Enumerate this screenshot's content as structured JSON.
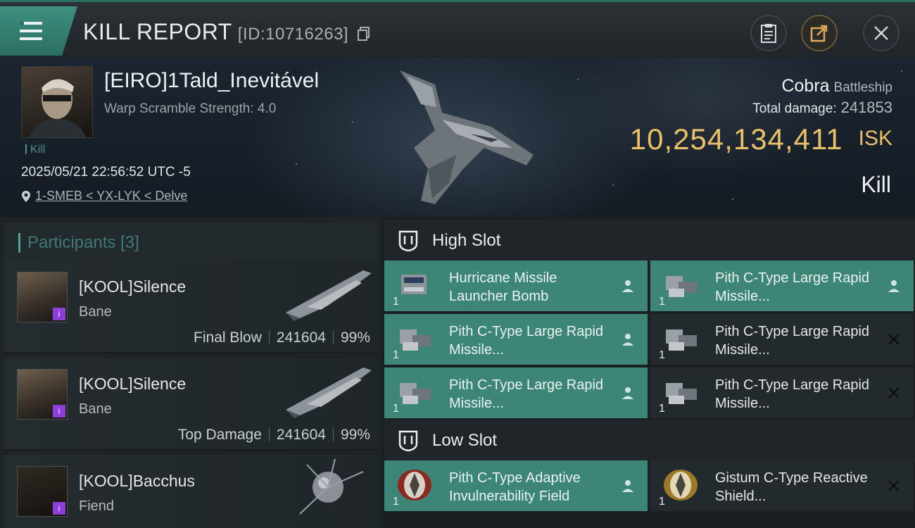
{
  "header": {
    "title": "KILL REPORT",
    "report_id": "[ID:10716263]"
  },
  "victim": {
    "name": "[EIRO]1Tald_Inevitável",
    "warp_scramble": "Warp Scramble Strength: 4.0",
    "tag": "Kill",
    "datetime": "2025/05/21 22:56:52 UTC -5",
    "location": "1-SMEB < YX-LYK < Delve",
    "ship_name": "Cobra",
    "ship_class": "Battleship",
    "total_damage_label": "Total damage:",
    "total_damage": "241853",
    "isk_value": "10,254,134,411",
    "isk_unit": "ISK",
    "result": "Kill"
  },
  "participants": {
    "label": "Participants",
    "count": "[3]",
    "items": [
      {
        "name": "[KOOL]Silence",
        "ship": "Bane",
        "role": "Final Blow",
        "damage": "241604",
        "percent": "99%"
      },
      {
        "name": "[KOOL]Silence",
        "ship": "Bane",
        "role": "Top Damage",
        "damage": "241604",
        "percent": "99%"
      },
      {
        "name": "[KOOL]Bacchus",
        "ship": "Fiend",
        "role": "",
        "damage": "",
        "percent": ""
      }
    ]
  },
  "fittings": {
    "high_slot_label": "High Slot",
    "low_slot_label": "Low Slot",
    "high": [
      {
        "name": "Hurricane Missile Launcher Bomb",
        "qty": "1",
        "status": "dropped"
      },
      {
        "name": "Pith C-Type Large Rapid Missile...",
        "qty": "1",
        "status": "dropped"
      },
      {
        "name": "Pith C-Type Large Rapid Missile...",
        "qty": "1",
        "status": "dropped"
      },
      {
        "name": "Pith C-Type Large Rapid Missile...",
        "qty": "1",
        "status": "destroyed"
      },
      {
        "name": "Pith C-Type Large Rapid Missile...",
        "qty": "1",
        "status": "dropped"
      },
      {
        "name": "Pith C-Type Large Rapid Missile...",
        "qty": "1",
        "status": "destroyed"
      }
    ],
    "low": [
      {
        "name": "Pith C-Type Adaptive Invulnerability Field",
        "qty": "1",
        "status": "dropped"
      },
      {
        "name": "Gistum C-Type Reactive Shield...",
        "qty": "1",
        "status": "destroyed"
      }
    ]
  },
  "colors": {
    "accent_teal": "#3d8577",
    "isk_gold": "#e9c16a",
    "badge_purple": "#8b3fd6"
  }
}
